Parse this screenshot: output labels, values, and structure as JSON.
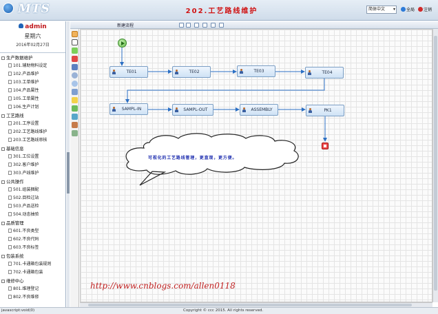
{
  "header": {
    "logo_text": "MTS",
    "page_title": "202.工艺路线维护",
    "language": "简体中文",
    "links": [
      {
        "label": "全局",
        "color": "#2d7bd8"
      },
      {
        "label": "注销",
        "color": "#d02a2a"
      }
    ]
  },
  "user": {
    "name": "admin",
    "weekday": "星期六",
    "date": "2016年02月27日"
  },
  "sidebar": {
    "groups": [
      {
        "label": "生产数据维护",
        "items": [
          "101.辅助物料设定",
          "102.产品维护",
          "103.工单维护",
          "104.产品属性",
          "105.工单属性",
          "106.生产计划"
        ]
      },
      {
        "label": "工艺路线",
        "items": [
          "201.工序设置",
          "202.工艺路线维护",
          "203.工艺路线审核"
        ]
      },
      {
        "label": "基础信息",
        "items": [
          "301.工位设置",
          "302.客户维护",
          "303.产线维护"
        ]
      },
      {
        "label": "公共操作",
        "items": [
          "501.组装捆配",
          "502.目检过站",
          "503.产品送检",
          "504.动态抽验"
        ]
      },
      {
        "label": "品质管理",
        "items": [
          "601.不良类型",
          "602.不良代码",
          "603.不良标签"
        ]
      },
      {
        "label": "包装系统",
        "items": [
          "701.卡通箱包装规则",
          "702.卡通箱包装"
        ]
      },
      {
        "label": "维修中心",
        "items": [
          "801.维理登记",
          "802.不良维修"
        ]
      }
    ]
  },
  "editor": {
    "flow_name": "新建流程"
  },
  "flow": {
    "row1": [
      "TE01",
      "TE02",
      "TE03",
      "TE04"
    ],
    "row2": [
      "SAMPL-IN",
      "SAMPL-OUT",
      "ASSEMBLY",
      "PK1"
    ]
  },
  "callout_text": "可视化的工艺路线管理，更直观，更方便。",
  "watermark": "http://www.cnblogs.com/allen0118",
  "status": {
    "left": "javascript:void(0)",
    "copyright": "Copyright © ccc 2015. All rights reserved."
  }
}
